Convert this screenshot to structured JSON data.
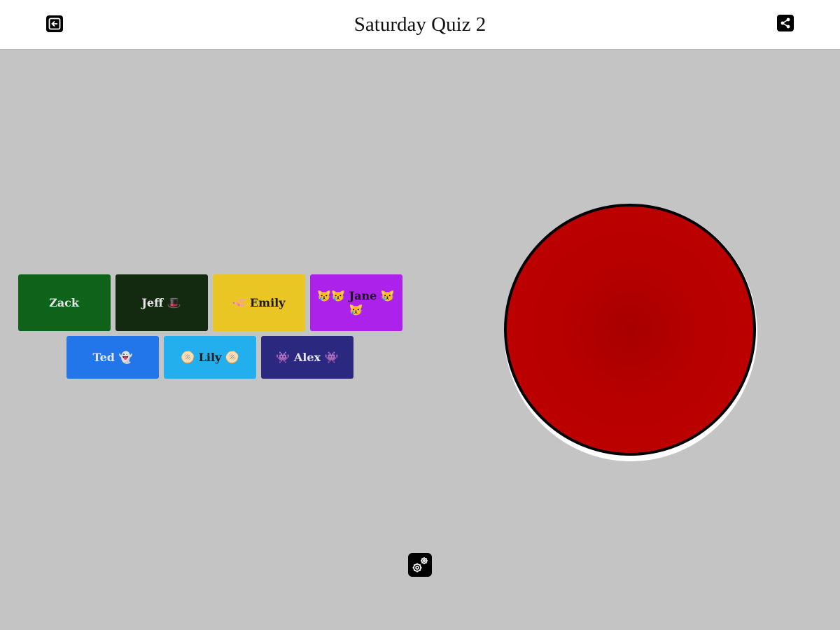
{
  "header": {
    "title": "Saturday Quiz 2",
    "exit_icon": "exit-icon",
    "share_icon": "share-icon"
  },
  "players": [
    {
      "label": "Zack",
      "bg": "#0f6219",
      "color": "#e6e6e6"
    },
    {
      "label": "Jeff 🎩",
      "bg": "#132a10",
      "color": "#e6e6e6"
    },
    {
      "label": "🪱 Emily",
      "bg": "#e9c623",
      "color": "#1a1a1a"
    },
    {
      "label": "😿😿 Jane 😿😿",
      "bg": "#ac22ea",
      "color": "#1a1a1a"
    },
    {
      "label": "Ted 👻",
      "bg": "#2276ea",
      "color": "#e6e6e6"
    },
    {
      "label": "🫓 Lily 🫓",
      "bg": "#23aeee",
      "color": "#1a1a1a"
    },
    {
      "label": "👾 Alex 👾",
      "bg": "#2b2880",
      "color": "#e6e6e6"
    }
  ],
  "buzzer": {
    "color": "#c00000",
    "rim_color": "#000000"
  },
  "footer": {
    "settings_icon": "gears-icon"
  }
}
